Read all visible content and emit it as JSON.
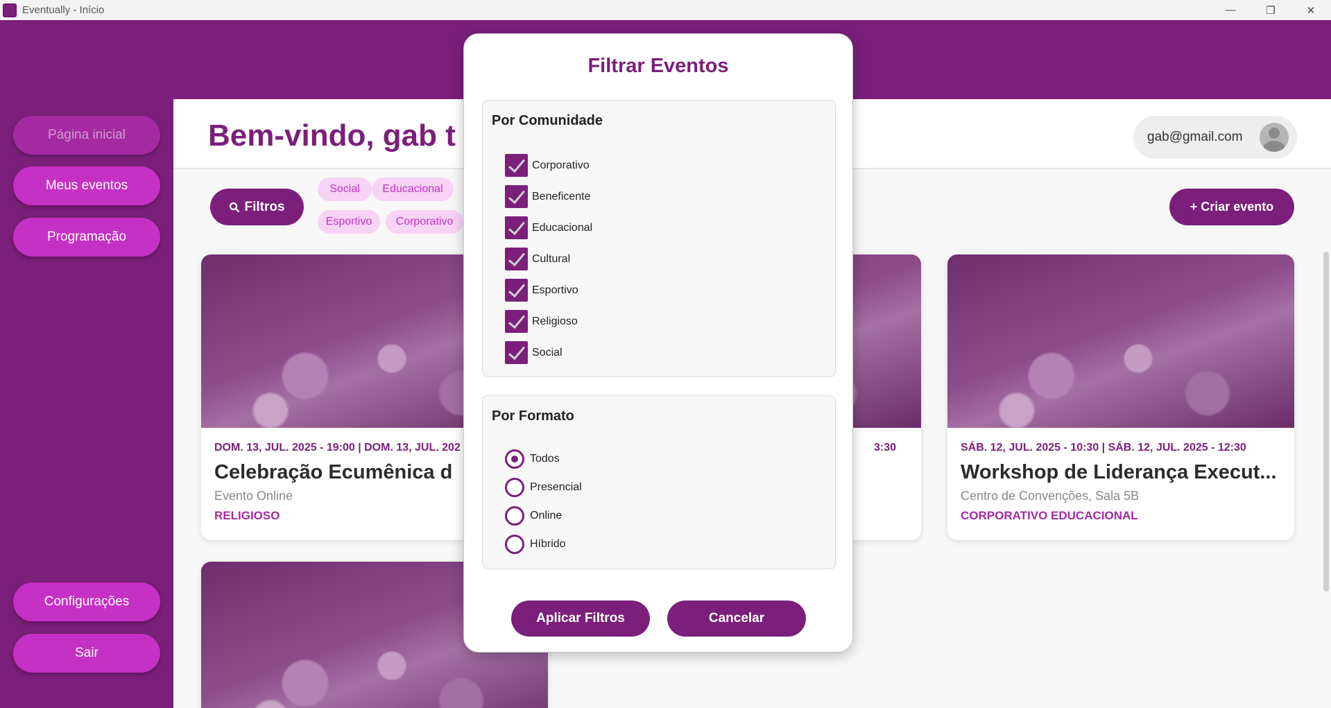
{
  "window": {
    "title": "Eventually - Início",
    "controls": [
      "—",
      "❐",
      "✕"
    ]
  },
  "sidebar": {
    "items": [
      {
        "label": "Página inicial"
      },
      {
        "label": "Meus eventos"
      },
      {
        "label": "Programação"
      },
      {
        "label": "Configurações"
      },
      {
        "label": "Sair"
      }
    ]
  },
  "header": {
    "welcome": "Bem-vindo, gab t",
    "user_email": "gab@gmail.com"
  },
  "toolbar": {
    "filters_label": "Filtros",
    "filters_icon": "search-icon",
    "chips": [
      "Social",
      "Educacional",
      "Esportivo",
      "Corporativo"
    ],
    "create_label": "+ Criar evento"
  },
  "cards": [
    {
      "date": "DOM. 13, JUL. 2025 - 19:00 | DOM. 13, JUL. 202",
      "title": "Celebração Ecumênica d",
      "location": "Evento Online",
      "tags": "RELIGIOSO"
    },
    {
      "date": "3:30",
      "title": "",
      "location": "",
      "tags": ""
    },
    {
      "date": "SÁB. 12, JUL. 2025 - 10:30 | SÁB. 12, JUL. 2025 - 12:30",
      "title": "Workshop de Liderança Execut...",
      "location": "Centro de Convenções, Sala 5B",
      "tags": "CORPORATIVO  EDUCACIONAL"
    }
  ],
  "modal": {
    "title": "Filtrar Eventos",
    "community": {
      "title": "Por Comunidade",
      "options": [
        {
          "label": "Corporativo",
          "checked": true
        },
        {
          "label": "Beneficente",
          "checked": true
        },
        {
          "label": "Educacional",
          "checked": true
        },
        {
          "label": "Cultural",
          "checked": true
        },
        {
          "label": "Esportivo",
          "checked": true
        },
        {
          "label": "Religioso",
          "checked": true
        },
        {
          "label": "Social",
          "checked": true
        }
      ]
    },
    "format": {
      "title": "Por Formato",
      "options": [
        {
          "label": "Todos",
          "selected": true
        },
        {
          "label": "Presencial",
          "selected": false
        },
        {
          "label": "Online",
          "selected": false
        },
        {
          "label": "Híbrido",
          "selected": false
        }
      ]
    },
    "apply_label": "Aplicar Filtros",
    "cancel_label": "Cancelar"
  },
  "colors": {
    "brand": "#7b1f7a",
    "accent": "#c531c4",
    "chip_bg": "#f7d3f6"
  }
}
